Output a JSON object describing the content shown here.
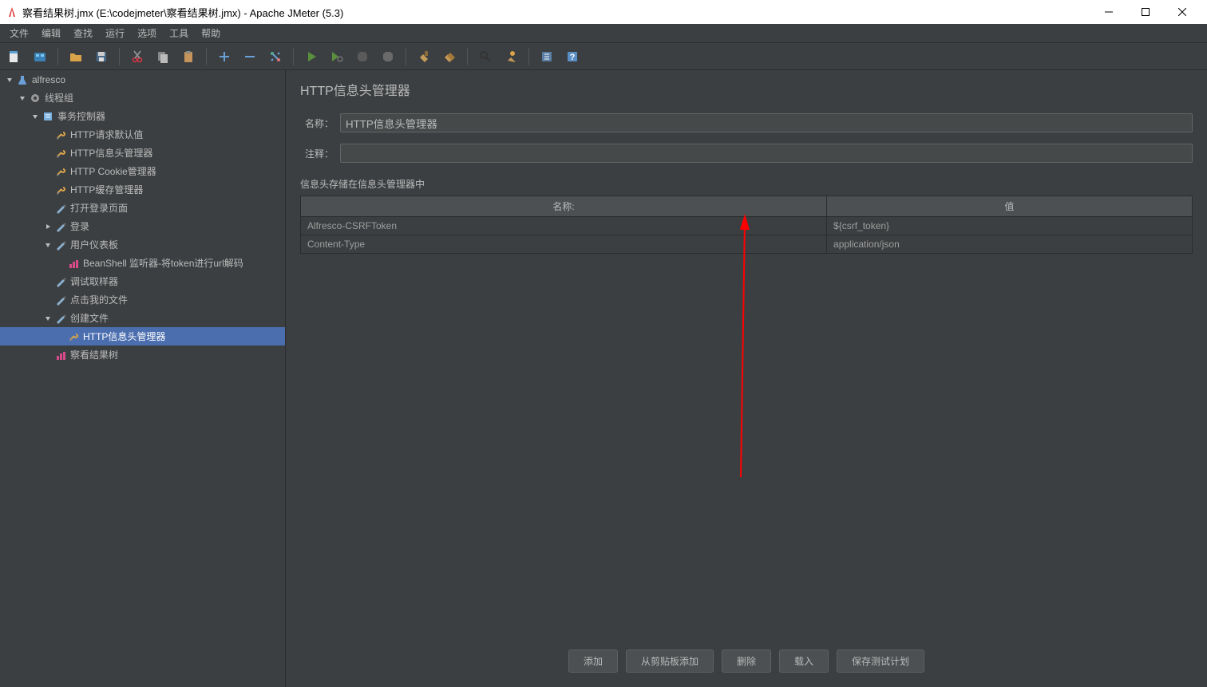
{
  "window": {
    "title": "察看结果树.jmx (E:\\codejmeter\\察看结果树.jmx) - Apache JMeter (5.3)"
  },
  "menu": {
    "items": [
      "文件",
      "编辑",
      "查找",
      "运行",
      "选项",
      "工具",
      "帮助"
    ]
  },
  "tree": {
    "nodes": [
      {
        "indent": 0,
        "toggle": "down",
        "icon": "flask",
        "label": "alfresco"
      },
      {
        "indent": 1,
        "toggle": "down",
        "icon": "gear",
        "label": "线程组"
      },
      {
        "indent": 2,
        "toggle": "down",
        "icon": "doc",
        "label": "事务控制器"
      },
      {
        "indent": 3,
        "toggle": "none",
        "icon": "wrench",
        "label": "HTTP请求默认值"
      },
      {
        "indent": 3,
        "toggle": "none",
        "icon": "wrench",
        "label": "HTTP信息头管理器"
      },
      {
        "indent": 3,
        "toggle": "none",
        "icon": "wrench",
        "label": "HTTP Cookie管理器"
      },
      {
        "indent": 3,
        "toggle": "none",
        "icon": "wrench",
        "label": "HTTP缓存管理器"
      },
      {
        "indent": 3,
        "toggle": "none",
        "icon": "pen",
        "label": "打开登录页面"
      },
      {
        "indent": 3,
        "toggle": "right",
        "icon": "pen",
        "label": "登录"
      },
      {
        "indent": 3,
        "toggle": "down",
        "icon": "pen",
        "label": "用户仪表板"
      },
      {
        "indent": 4,
        "toggle": "none",
        "icon": "chart",
        "label": "BeanShell 监听器-将token进行url解码"
      },
      {
        "indent": 3,
        "toggle": "none",
        "icon": "pen",
        "label": "调试取样器"
      },
      {
        "indent": 3,
        "toggle": "none",
        "icon": "pen",
        "label": "点击我的文件"
      },
      {
        "indent": 3,
        "toggle": "down",
        "icon": "pen",
        "label": "创建文件"
      },
      {
        "indent": 4,
        "toggle": "none",
        "icon": "wrench",
        "label": "HTTP信息头管理器",
        "selected": true
      },
      {
        "indent": 3,
        "toggle": "none",
        "icon": "chart",
        "label": "察看结果树"
      }
    ]
  },
  "panel": {
    "title": "HTTP信息头管理器",
    "name_label": "名称：",
    "name_value": "HTTP信息头管理器",
    "comment_label": "注释：",
    "comment_value": "",
    "section": "信息头存储在信息头管理器中",
    "col_name": "名称:",
    "col_value": "值",
    "rows": [
      {
        "name": "Alfresco-CSRFToken",
        "value": "${csrf_token}"
      },
      {
        "name": "Content-Type",
        "value": "application/json"
      }
    ]
  },
  "buttons": {
    "add": "添加",
    "add_clipboard": "从剪贴板添加",
    "delete": "删除",
    "load": "载入",
    "save": "保存测试计划"
  }
}
